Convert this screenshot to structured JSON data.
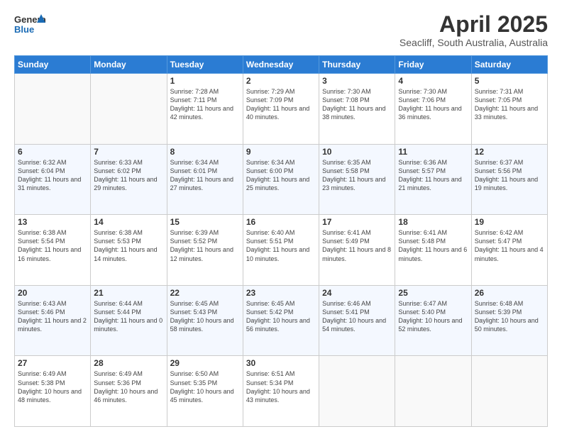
{
  "header": {
    "logo_general": "General",
    "logo_blue": "Blue",
    "month_year": "April 2025",
    "location": "Seacliff, South Australia, Australia"
  },
  "days_of_week": [
    "Sunday",
    "Monday",
    "Tuesday",
    "Wednesday",
    "Thursday",
    "Friday",
    "Saturday"
  ],
  "weeks": [
    [
      {
        "day": null
      },
      {
        "day": null
      },
      {
        "day": "1",
        "sunrise": "Sunrise: 7:28 AM",
        "sunset": "Sunset: 7:11 PM",
        "daylight": "Daylight: 11 hours and 42 minutes."
      },
      {
        "day": "2",
        "sunrise": "Sunrise: 7:29 AM",
        "sunset": "Sunset: 7:09 PM",
        "daylight": "Daylight: 11 hours and 40 minutes."
      },
      {
        "day": "3",
        "sunrise": "Sunrise: 7:30 AM",
        "sunset": "Sunset: 7:08 PM",
        "daylight": "Daylight: 11 hours and 38 minutes."
      },
      {
        "day": "4",
        "sunrise": "Sunrise: 7:30 AM",
        "sunset": "Sunset: 7:06 PM",
        "daylight": "Daylight: 11 hours and 36 minutes."
      },
      {
        "day": "5",
        "sunrise": "Sunrise: 7:31 AM",
        "sunset": "Sunset: 7:05 PM",
        "daylight": "Daylight: 11 hours and 33 minutes."
      }
    ],
    [
      {
        "day": "6",
        "sunrise": "Sunrise: 6:32 AM",
        "sunset": "Sunset: 6:04 PM",
        "daylight": "Daylight: 11 hours and 31 minutes."
      },
      {
        "day": "7",
        "sunrise": "Sunrise: 6:33 AM",
        "sunset": "Sunset: 6:02 PM",
        "daylight": "Daylight: 11 hours and 29 minutes."
      },
      {
        "day": "8",
        "sunrise": "Sunrise: 6:34 AM",
        "sunset": "Sunset: 6:01 PM",
        "daylight": "Daylight: 11 hours and 27 minutes."
      },
      {
        "day": "9",
        "sunrise": "Sunrise: 6:34 AM",
        "sunset": "Sunset: 6:00 PM",
        "daylight": "Daylight: 11 hours and 25 minutes."
      },
      {
        "day": "10",
        "sunrise": "Sunrise: 6:35 AM",
        "sunset": "Sunset: 5:58 PM",
        "daylight": "Daylight: 11 hours and 23 minutes."
      },
      {
        "day": "11",
        "sunrise": "Sunrise: 6:36 AM",
        "sunset": "Sunset: 5:57 PM",
        "daylight": "Daylight: 11 hours and 21 minutes."
      },
      {
        "day": "12",
        "sunrise": "Sunrise: 6:37 AM",
        "sunset": "Sunset: 5:56 PM",
        "daylight": "Daylight: 11 hours and 19 minutes."
      }
    ],
    [
      {
        "day": "13",
        "sunrise": "Sunrise: 6:38 AM",
        "sunset": "Sunset: 5:54 PM",
        "daylight": "Daylight: 11 hours and 16 minutes."
      },
      {
        "day": "14",
        "sunrise": "Sunrise: 6:38 AM",
        "sunset": "Sunset: 5:53 PM",
        "daylight": "Daylight: 11 hours and 14 minutes."
      },
      {
        "day": "15",
        "sunrise": "Sunrise: 6:39 AM",
        "sunset": "Sunset: 5:52 PM",
        "daylight": "Daylight: 11 hours and 12 minutes."
      },
      {
        "day": "16",
        "sunrise": "Sunrise: 6:40 AM",
        "sunset": "Sunset: 5:51 PM",
        "daylight": "Daylight: 11 hours and 10 minutes."
      },
      {
        "day": "17",
        "sunrise": "Sunrise: 6:41 AM",
        "sunset": "Sunset: 5:49 PM",
        "daylight": "Daylight: 11 hours and 8 minutes."
      },
      {
        "day": "18",
        "sunrise": "Sunrise: 6:41 AM",
        "sunset": "Sunset: 5:48 PM",
        "daylight": "Daylight: 11 hours and 6 minutes."
      },
      {
        "day": "19",
        "sunrise": "Sunrise: 6:42 AM",
        "sunset": "Sunset: 5:47 PM",
        "daylight": "Daylight: 11 hours and 4 minutes."
      }
    ],
    [
      {
        "day": "20",
        "sunrise": "Sunrise: 6:43 AM",
        "sunset": "Sunset: 5:46 PM",
        "daylight": "Daylight: 11 hours and 2 minutes."
      },
      {
        "day": "21",
        "sunrise": "Sunrise: 6:44 AM",
        "sunset": "Sunset: 5:44 PM",
        "daylight": "Daylight: 11 hours and 0 minutes."
      },
      {
        "day": "22",
        "sunrise": "Sunrise: 6:45 AM",
        "sunset": "Sunset: 5:43 PM",
        "daylight": "Daylight: 10 hours and 58 minutes."
      },
      {
        "day": "23",
        "sunrise": "Sunrise: 6:45 AM",
        "sunset": "Sunset: 5:42 PM",
        "daylight": "Daylight: 10 hours and 56 minutes."
      },
      {
        "day": "24",
        "sunrise": "Sunrise: 6:46 AM",
        "sunset": "Sunset: 5:41 PM",
        "daylight": "Daylight: 10 hours and 54 minutes."
      },
      {
        "day": "25",
        "sunrise": "Sunrise: 6:47 AM",
        "sunset": "Sunset: 5:40 PM",
        "daylight": "Daylight: 10 hours and 52 minutes."
      },
      {
        "day": "26",
        "sunrise": "Sunrise: 6:48 AM",
        "sunset": "Sunset: 5:39 PM",
        "daylight": "Daylight: 10 hours and 50 minutes."
      }
    ],
    [
      {
        "day": "27",
        "sunrise": "Sunrise: 6:49 AM",
        "sunset": "Sunset: 5:38 PM",
        "daylight": "Daylight: 10 hours and 48 minutes."
      },
      {
        "day": "28",
        "sunrise": "Sunrise: 6:49 AM",
        "sunset": "Sunset: 5:36 PM",
        "daylight": "Daylight: 10 hours and 46 minutes."
      },
      {
        "day": "29",
        "sunrise": "Sunrise: 6:50 AM",
        "sunset": "Sunset: 5:35 PM",
        "daylight": "Daylight: 10 hours and 45 minutes."
      },
      {
        "day": "30",
        "sunrise": "Sunrise: 6:51 AM",
        "sunset": "Sunset: 5:34 PM",
        "daylight": "Daylight: 10 hours and 43 minutes."
      },
      {
        "day": null
      },
      {
        "day": null
      },
      {
        "day": null
      }
    ]
  ]
}
